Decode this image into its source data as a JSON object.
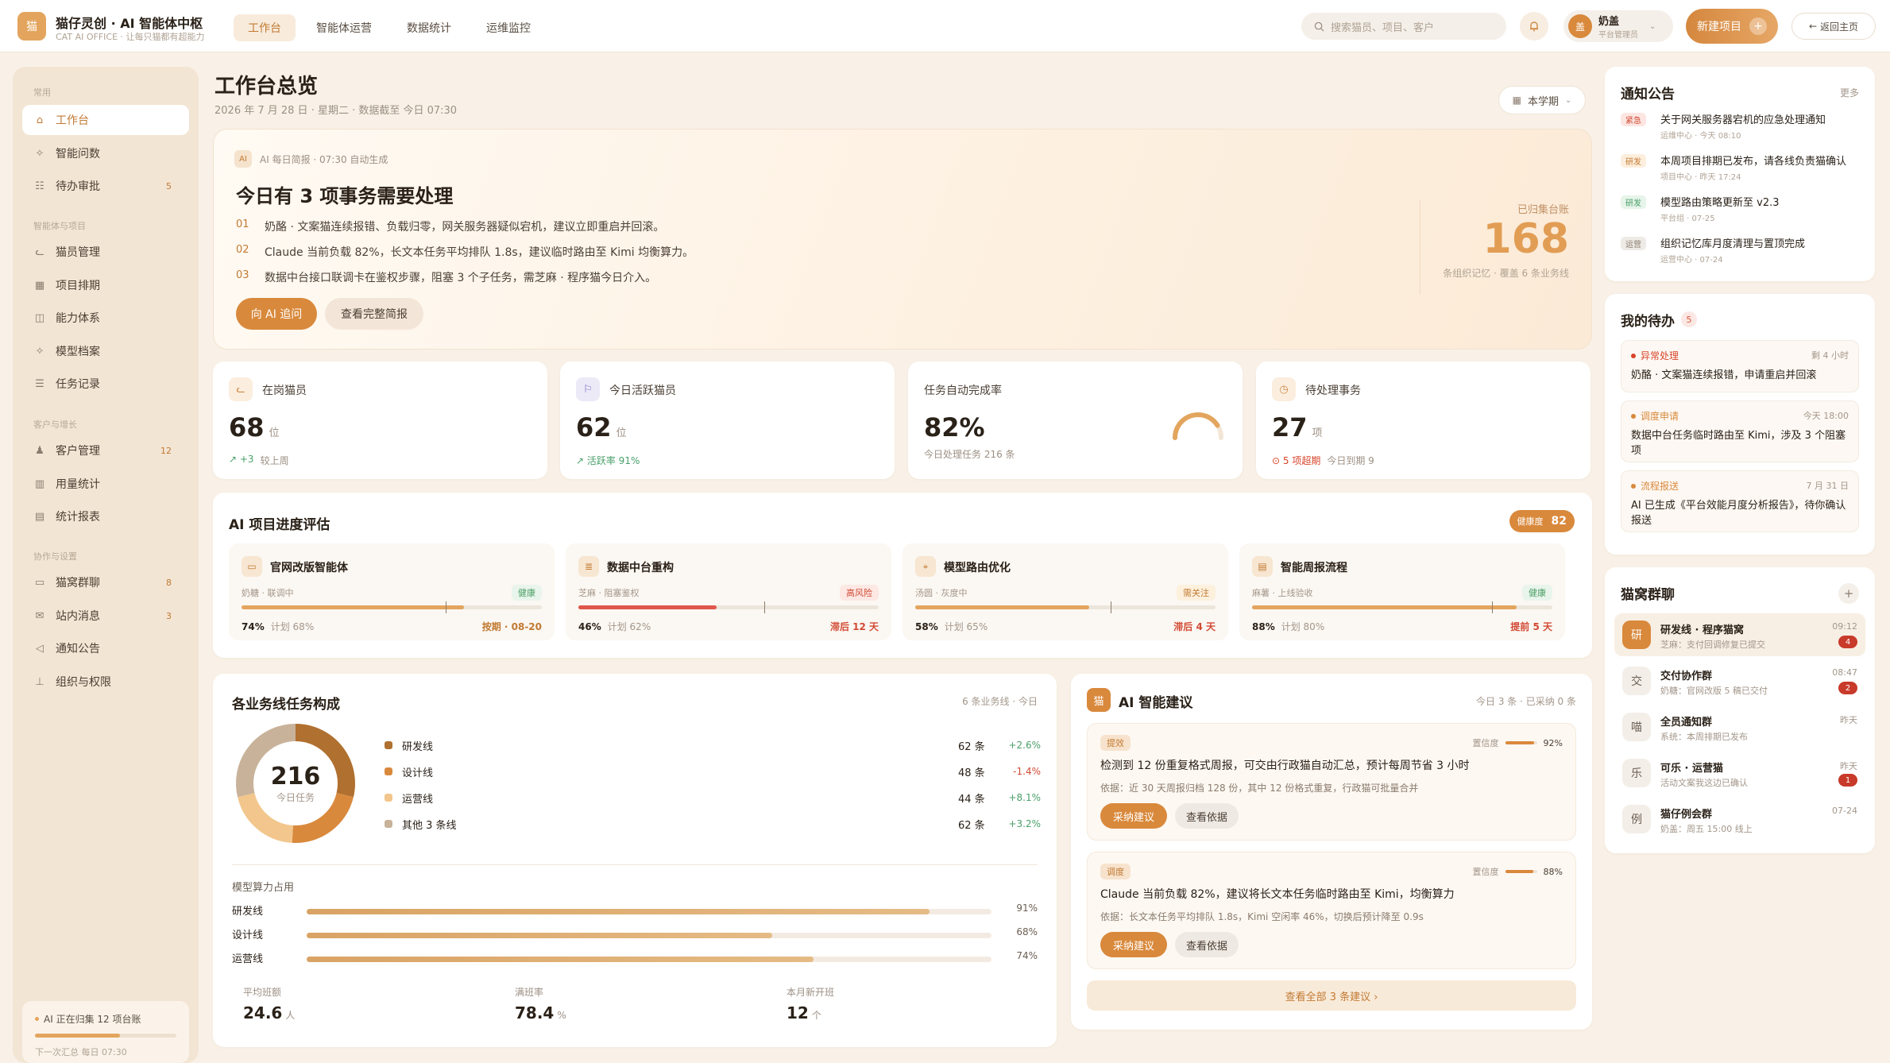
{
  "header": {
    "logo": "猫",
    "title": "猫仔灵创 · AI 智能体中枢",
    "subtitle": "CAT AI OFFICE · 让每只猫都有超能力",
    "nav": [
      "工作台",
      "智能体运营",
      "数据统计",
      "运维监控"
    ],
    "active_nav": "工作台",
    "search_placeholder": "搜索猫员、项目、客户",
    "user_avatar": "盖",
    "user_name": "奶盖",
    "user_role": "平台管理员",
    "new_project": "新建项目",
    "back_home": "返回主页"
  },
  "sidebar": {
    "sections": [
      {
        "title": "常用",
        "items": [
          {
            "label": "工作台",
            "icon": "home-icon",
            "active": true
          },
          {
            "label": "智能问数",
            "icon": "sparkle-icon"
          },
          {
            "label": "待办审批",
            "icon": "checklist-icon",
            "badge": "5"
          }
        ]
      },
      {
        "title": "智能体与项目",
        "items": [
          {
            "label": "猫员管理",
            "icon": "cat-icon"
          },
          {
            "label": "项目排期",
            "icon": "calendar-icon"
          },
          {
            "label": "能力体系",
            "icon": "layers-icon"
          },
          {
            "label": "模型档案",
            "icon": "sparkle-icon"
          },
          {
            "label": "任务记录",
            "icon": "list-icon"
          }
        ]
      },
      {
        "title": "客户与增长",
        "items": [
          {
            "label": "客户管理",
            "icon": "users-icon",
            "badge": "12"
          },
          {
            "label": "用量统计",
            "icon": "bar-chart-icon"
          },
          {
            "label": "统计报表",
            "icon": "report-icon"
          }
        ]
      },
      {
        "title": "协作与设置",
        "items": [
          {
            "label": "猫窝群聊",
            "icon": "chat-icon",
            "badge": "8"
          },
          {
            "label": "站内消息",
            "icon": "mail-icon",
            "badge": "3"
          },
          {
            "label": "通知公告",
            "icon": "megaphone-icon"
          },
          {
            "label": "组织与权限",
            "icon": "org-icon"
          }
        ]
      }
    ],
    "footer": {
      "title": "AI 正在归集 12 项台账",
      "sub": "下一次汇总 每日 07:30",
      "progress": 0.6
    }
  },
  "overview": {
    "title": "工作台总览",
    "subtitle": "2026 年 7 月 28 日 · 星期二 · 数据截至 今日 07:30",
    "term": "本学期"
  },
  "brief": {
    "tag_icon": "AI",
    "tag": "AI 每日简报 · 07:30 自动生成",
    "title": "今日有 3 项事务需要处理",
    "lines": [
      {
        "no": "01",
        "text": "奶酪 · 文案猫连续报错、负载归零，网关服务器疑似宕机，建议立即重启并回滚。"
      },
      {
        "no": "02",
        "text": "Claude 当前负载 82%，长文本任务平均排队 1.8s，建议临时路由至 Kimi 均衡算力。"
      },
      {
        "no": "03",
        "text": "数据中台接口联调卡在鉴权步骤，阻塞 3 个子任务，需芝麻 · 程序猫今日介入。"
      }
    ],
    "btn_ask": "向 AI 追问",
    "btn_full": "查看完整简报",
    "kpi_label": "已归集台账",
    "kpi_value": "168",
    "kpi_sub": "条组织记忆 · 覆盖 6 条业务线"
  },
  "stats": [
    {
      "label": "在岗猫员",
      "value": "68",
      "unit": "位",
      "foot1": "↗ +3",
      "foot2": "较上周",
      "icon": "cat-icon"
    },
    {
      "label": "今日活跃猫员",
      "value": "62",
      "unit": "位",
      "foot1": "↗ 活跃率 91%",
      "foot2": "",
      "icon": "flag-icon"
    },
    {
      "label": "任务自动完成率",
      "value": "82%",
      "unit": "",
      "foot1": "今日处理任务 216 条",
      "foot2": "",
      "gauge": 0.82
    },
    {
      "label": "待处理事务",
      "value": "27",
      "unit": "项",
      "foot1": "⊙ 5 项超期",
      "foot2": "今日到期 9",
      "icon": "clock-icon"
    }
  ],
  "progress": {
    "title": "AI 项目进度评估",
    "health_label": "健康度",
    "health_value": "82",
    "projects": [
      {
        "name": "官网改版智能体",
        "owner": "奶糖 · 联调中",
        "tag": "健康",
        "tag_type": "ok",
        "value": "74%",
        "actual": 0.74,
        "plan_label": "计划 68%",
        "plan": 0.68,
        "status": "按期 · 08-20",
        "status_type": "warn",
        "icon": "monitor-icon"
      },
      {
        "name": "数据中台重构",
        "owner": "芝麻 · 阻塞鉴权",
        "tag": "高风险",
        "tag_type": "bad",
        "value": "46%",
        "actual": 0.46,
        "plan_label": "计划 62%",
        "plan": 0.62,
        "status": "滞后 12 天",
        "status_type": "bad",
        "icon": "database-icon"
      },
      {
        "name": "模型路由优化",
        "owner": "汤圆 · 灰度中",
        "tag": "需关注",
        "tag_type": "warn",
        "value": "58%",
        "actual": 0.58,
        "plan_label": "计划 65%",
        "plan": 0.65,
        "status": "滞后 4 天",
        "status_type": "bad",
        "icon": "route-icon"
      },
      {
        "name": "智能周报流程",
        "owner": "麻薯 · 上线验收",
        "tag": "健康",
        "tag_type": "ok",
        "value": "88%",
        "actual": 0.88,
        "plan_label": "计划 80%",
        "plan": 0.8,
        "status": "提前 5 天",
        "status_type": "bad",
        "icon": "doc-icon"
      }
    ]
  },
  "composition": {
    "title": "各业务线任务构成",
    "right": "6 条业务线 · 今日",
    "total": "216",
    "total_label": "今日任务",
    "legend_colors": [
      "#b0702f",
      "#d9893c",
      "#f2c68c",
      "#c8b29a"
    ],
    "chart_data": {
      "type": "pie",
      "categories": [
        "研发线",
        "设计线",
        "运营线",
        "其他 3 条线"
      ],
      "values": [
        62,
        48,
        44,
        62
      ],
      "labels": [
        "62 条",
        "48 条",
        "44 条",
        "62 条"
      ],
      "deltas": [
        "+2.6%",
        "-1.4%",
        "+8.1%",
        "+3.2%"
      ]
    },
    "compute_label": "模型算力占用",
    "compute": [
      {
        "name": "研发线",
        "pct_label": "91%",
        "value": 0.91
      },
      {
        "name": "设计线",
        "pct_label": "68%",
        "value": 0.68
      },
      {
        "name": "运营线",
        "pct_label": "74%",
        "value": 0.74
      }
    ],
    "stats": [
      {
        "label": "平均班额",
        "value": "24.6",
        "unit": "人"
      },
      {
        "label": "满班率",
        "value": "78.4",
        "unit": "%"
      },
      {
        "label": "本月新开班",
        "value": "12",
        "unit": "个"
      }
    ]
  },
  "ai": {
    "icon": "猫",
    "title": "AI 智能建议",
    "right": "今日 3 条 · 已采纳 0 条",
    "suggestions": [
      {
        "tag": "提效",
        "conf_label": "置信度",
        "conf": "92%",
        "conf_value": 0.92,
        "title": "检测到 12 份重复格式周报，可交由行政猫自动汇总，预计每周节省 3 小时",
        "basis": "依据：近 30 天周报归档 128 份，其中 12 份格式重复，行政猫可批量合并",
        "adopt": "采纳建议",
        "view": "查看依据"
      },
      {
        "tag": "调度",
        "conf_label": "置信度",
        "conf": "88%",
        "conf_value": 0.88,
        "title": "Claude 当前负载 82%，建议将长文本任务临时路由至 Kimi，均衡算力",
        "basis": "依据：长文本任务平均排队 1.8s，Kimi 空闲率 46%，切换后预计降至 0.9s",
        "adopt": "采纳建议",
        "view": "查看依据"
      }
    ],
    "more": "查看全部 3 条建议 ›"
  },
  "notice": {
    "title": "通知公告",
    "more": "更多",
    "items": [
      {
        "tag": "紧急",
        "type": "urgent",
        "text": "关于网关服务器宕机的应急处理通知",
        "meta": "运维中心 · 今天 08:10"
      },
      {
        "tag": "研发",
        "type": "dev",
        "text": "本周项目排期已发布，请各线负责猫确认",
        "meta": "项目中心 · 昨天 17:24"
      },
      {
        "tag": "研发",
        "type": "green",
        "text": "模型路由策略更新至 v2.3",
        "meta": "平台组 · 07-25"
      },
      {
        "tag": "运营",
        "type": "gray",
        "text": "组织记忆库月度清理与置顶完成",
        "meta": "运营中心 · 07-24"
      }
    ]
  },
  "todo": {
    "title": "我的待办",
    "count": "5",
    "items": [
      {
        "type": "异常处理",
        "type_color": "#d8442a",
        "time": "剩 4 小时",
        "text": "奶酪 · 文案猫连续报错，申请重启并回滚"
      },
      {
        "type": "调度申请",
        "type_color": "#d9893c",
        "time": "今天 18:00",
        "text": "数据中台任务临时路由至 Kimi，涉及 3 个阻塞项"
      },
      {
        "type": "流程报送",
        "type_color": "#d9893c",
        "time": "7 月 31 日",
        "text": "AI 已生成《平台效能月度分析报告》，待你确认报送"
      }
    ]
  },
  "groups": {
    "title": "猫窝群聊",
    "add": "+",
    "items": [
      {
        "avatar": "研",
        "name": "研发线 · 程序猫窝",
        "msg": "芝麻：支付回调修复已提交",
        "time": "09:12",
        "badge": "4",
        "active": true
      },
      {
        "avatar": "交",
        "name": "交付协作群",
        "msg": "奶糖：官网改版 5 稿已交付",
        "time": "08:47",
        "badge": "2"
      },
      {
        "avatar": "喵",
        "name": "全员通知群",
        "msg": "系统：本周排期已发布",
        "time": "昨天",
        "badge": ""
      },
      {
        "avatar": "乐",
        "name": "可乐 · 运营猫",
        "msg": "活动文案我这边已确认",
        "time": "昨天",
        "badge": "1"
      },
      {
        "avatar": "例",
        "name": "猫仔例会群",
        "msg": "奶盖：周五 15:00 线上",
        "time": "07-24",
        "badge": ""
      }
    ]
  }
}
